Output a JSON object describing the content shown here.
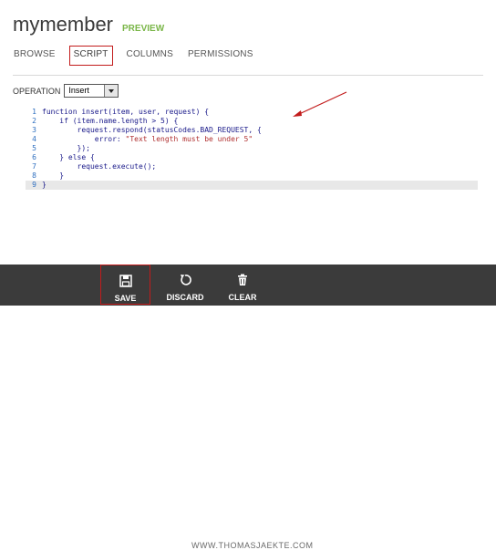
{
  "header": {
    "title": "mymember",
    "badge": "PREVIEW"
  },
  "tabs": [
    {
      "label": "BROWSE",
      "active": false
    },
    {
      "label": "SCRIPT",
      "active": true
    },
    {
      "label": "COLUMNS",
      "active": false
    },
    {
      "label": "PERMISSIONS",
      "active": false
    }
  ],
  "operation": {
    "label": "OPERATION",
    "selected": "Insert"
  },
  "editor": {
    "lines": [
      {
        "num": "1",
        "text": "function insert(item, user, request) {"
      },
      {
        "num": "2",
        "text": "    if (item.name.length > 5) {"
      },
      {
        "num": "3",
        "text": "        request.respond(statusCodes.BAD_REQUEST, {"
      },
      {
        "num": "4",
        "text": "            error: ",
        "str": "\"Text length must be under 5\""
      },
      {
        "num": "5",
        "text": "        });"
      },
      {
        "num": "6",
        "text": "    } else {"
      },
      {
        "num": "7",
        "text": "        request.execute();"
      },
      {
        "num": "8",
        "text": "    }"
      },
      {
        "num": "9",
        "text": "}"
      }
    ],
    "current_line": 9
  },
  "toolbar": {
    "save_label": "SAVE",
    "discard_label": "DISCARD",
    "clear_label": "CLEAR",
    "watermark": "WWW.THOMASJAEKTE.COM"
  },
  "colors": {
    "accent_red": "#c21b1b",
    "preview_green": "#7ab648",
    "bar_bg": "#3b3b3b"
  }
}
